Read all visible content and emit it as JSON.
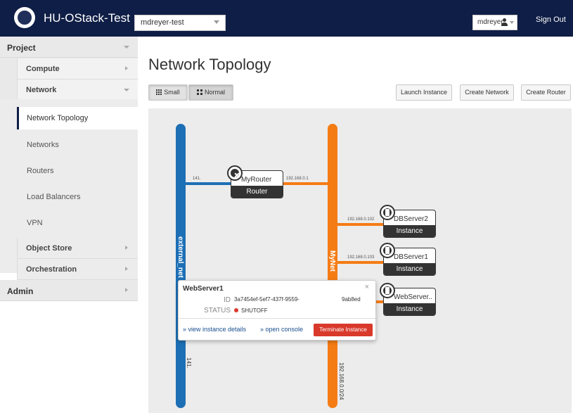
{
  "header": {
    "brand": "HU-OStack-Test",
    "project": "mdreyer-test",
    "user": "mdreyer",
    "sign_out": "Sign Out"
  },
  "sidebar": {
    "project": "Project",
    "compute": "Compute",
    "network": "Network",
    "items": [
      "Network Topology",
      "Networks",
      "Routers",
      "Load Balancers",
      "VPN"
    ],
    "object_store": "Object Store",
    "orchestration": "Orchestration",
    "admin": "Admin"
  },
  "main": {
    "title": "Network Topology",
    "view_small": "Small",
    "view_normal": "Normal",
    "launch_instance": "Launch Instance",
    "create_network": "Create Network",
    "create_router": "Create Router"
  },
  "topology": {
    "ext_net_label": "external_net",
    "ext_net_cidr": "141.",
    "my_net_label": "MyNet",
    "my_net_cidr": "192.168.0.0/24",
    "router_ext_ip": "141.",
    "router_int_ip": "192.168.0.1",
    "db2_ip": "192.168.0.102",
    "db1_ip": "192.168.0.103",
    "devices": {
      "router": {
        "name": "MyRouter",
        "type": "Router"
      },
      "db2": {
        "name": "DBServer2",
        "type": "Instance"
      },
      "db1": {
        "name": "DBServer1",
        "type": "Instance"
      },
      "web": {
        "name": "WebServer..",
        "type": "Instance"
      }
    },
    "colors": {
      "external": "#1d6fb5",
      "internal": "#f57c15"
    }
  },
  "popup": {
    "title": "WebServer1",
    "id_label": "ID",
    "id_value": "3a7454ef-5ef7-437f-9559-",
    "id_suffix": "9ab8ed",
    "status_label": "STATUS",
    "status_value": "SHUTOFF",
    "close": "×",
    "view_details": "» view instance details",
    "open_console": "» open console",
    "terminate": "Terminate Instance"
  }
}
